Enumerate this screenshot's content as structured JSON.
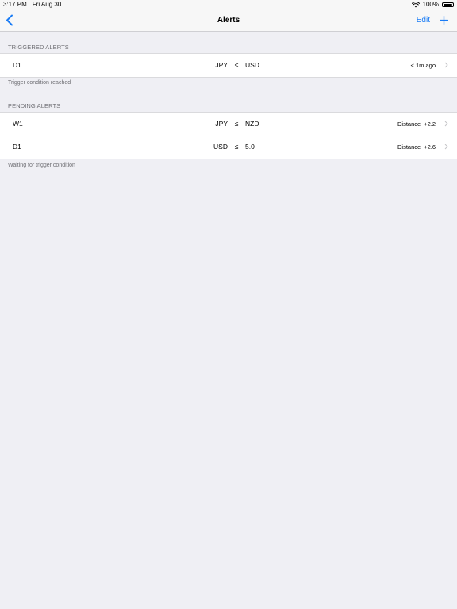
{
  "status_bar": {
    "time": "3:17 PM",
    "date": "Fri Aug 30",
    "battery": "100%",
    "battery_level": 1.0
  },
  "nav": {
    "title": "Alerts",
    "edit_label": "Edit",
    "back_icon": "chevron-left-icon",
    "add_icon": "plus-icon",
    "accent_color": "#1a7cf5"
  },
  "triggered": {
    "header": "TRIGGERED ALERTS",
    "footer": "Trigger condition reached",
    "rows": [
      {
        "timeframe": "D1",
        "lhs": "JPY",
        "op": "≤",
        "rhs": "USD",
        "detail_label": "",
        "detail_value": "< 1m ago"
      }
    ]
  },
  "pending": {
    "header": "PENDING ALERTS",
    "footer": "Waiting for trigger condition",
    "rows": [
      {
        "timeframe": "W1",
        "lhs": "JPY",
        "op": "≤",
        "rhs": "NZD",
        "detail_label": "Distance",
        "detail_value": "+2.2"
      },
      {
        "timeframe": "D1",
        "lhs": "USD",
        "op": "≤",
        "rhs": "5.0",
        "detail_label": "Distance",
        "detail_value": "+2.6"
      }
    ]
  }
}
